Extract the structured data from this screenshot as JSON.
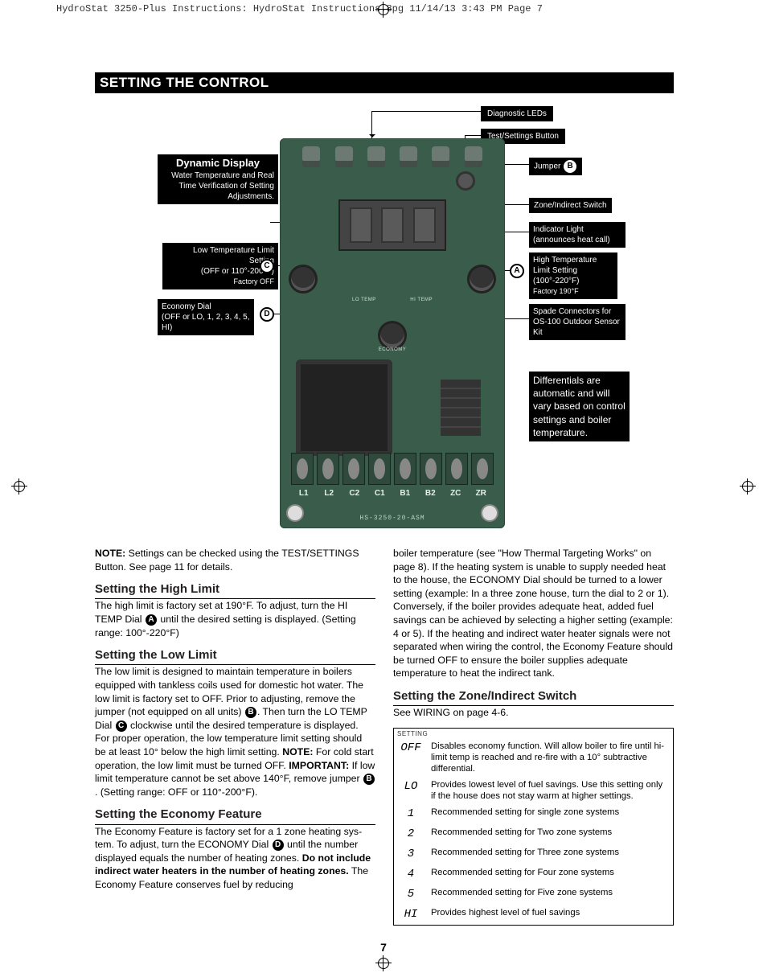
{
  "slug": "HydroStat 3250-Plus Instructions:  HydroStat Instructions.8pg   11/14/13  3:43 PM  Page 7",
  "section_bar": "SETTING THE CONTROL",
  "page_number": "7",
  "diagram": {
    "board_pn": "HS-3250-20-ASM",
    "terminals": [
      "L1",
      "L2",
      "C2",
      "C1",
      "B1",
      "B2",
      "ZC",
      "ZR"
    ],
    "left": {
      "dyn_title": "Dynamic Display",
      "dyn_sub": "Water Temperature and Real Time Verification of Setting Adjustments.",
      "lo_title": "Low Temperature Limit Setting",
      "lo_sub1": "(OFF or 110°-200°F)",
      "lo_sub2": "Factory OFF",
      "econ_title": "Economy Dial",
      "econ_sub": "(OFF or LO, 1, 2, 3, 4, 5, HI)"
    },
    "top": {
      "leds": "Diagnostic LEDs",
      "test": "Test/Settings Button"
    },
    "right": {
      "jumper": "Jumper",
      "zone": "Zone/Indirect Switch",
      "indic1": "Indicator Light",
      "indic2": "(announces heat call)",
      "hi1": "High Temperature Limit Setting",
      "hi2": "(100°-220°F)",
      "hi3": "Factory 190°F",
      "spade": "Spade Connectors for OS-100 Outdoor Sensor Kit",
      "diff": "Differentials are automatic and will vary based on control settings and boiler tem­perature."
    },
    "keys": {
      "A": "A",
      "B": "B",
      "C": "C",
      "D": "D"
    },
    "silk": {
      "lo": "LO TEMP",
      "hi": "HI TEMP",
      "econ": "ECONOMY"
    }
  },
  "col1": {
    "note": "NOTE: Settings can be checked using the TEST/SETTINGS Button. See page 11 for details.",
    "h_high": "Setting the High Limit",
    "p_high": "The high limit is factory set at 190°F. To adjust, turn the HI TEMP Dial {A} until the desired setting is displayed. (Setting range: 100°-220°F)",
    "h_low": "Setting the Low Limit",
    "p_low": "The low limit is designed to maintain temperature in boilers equipped with tankless coils used for domestic hot water. The low limit is factory set to OFF. Prior to adjusting, remove the jumper (not equipped on all units) {B}. Then turn the LO TEMP Dial {C} clockwise until the desired temperature is dis­played. For proper operation, the low temperature limit set­ting should be at least 10° below the high limit setting. NOTE: For cold start operation, the low limit must be turned OFF. IMPORTANT: If low limit temperature cannot be set above 140°F, remove jumper {B}. (Setting range: OFF or 110°-200°F).",
    "h_econ": "Setting the Economy Feature",
    "p_econ": "The Economy Feature is factory set for a 1 zone heating sys­tem. To adjust, turn the ECONOMY Dial {D} until the number displayed equals the number of heating zones. Do not include indirect water heaters in the number of heating zones. The Economy Feature conserves fuel by reducing"
  },
  "col2": {
    "p_cont": "boiler temperature (see \"How Thermal Targeting Works\" on page 8). If the heating system is unable to supply needed heat to the house, the ECONOMY Dial should be turned to a lower setting (example: In a three zone house, turn the dial to 2 or 1). Conversely, if the boiler provides adequate heat, added fuel savings can be achieved by selecting a higher set­ting (example: 4 or 5).  If the heating and indirect water heater signals were not separated when wiring the control, the Economy Feature should be turned OFF to ensure the boiler supplies adequate temperature to heat the indirect tank.",
    "h_zone": "Setting the Zone/Indirect Switch",
    "p_zone": "See WIRING on page 4-6.",
    "settings_hdr": "SETTING",
    "rows": [
      {
        "k": "OFF",
        "v": "Disables economy function. Will allow boiler to fire until hi-limit temp is reached and re-fire with a 10° subtractive differential."
      },
      {
        "k": "LO",
        "v": "Provides lowest level of fuel savings. Use this setting only if the house does not stay warm at higher settings."
      },
      {
        "k": "1",
        "v": "Recommended setting for single zone systems"
      },
      {
        "k": "2",
        "v": "Recommended setting for Two zone systems"
      },
      {
        "k": "3",
        "v": "Recommended setting for Three zone systems"
      },
      {
        "k": "4",
        "v": "Recommended setting for Four zone systems"
      },
      {
        "k": "5",
        "v": "Recommended setting for Five zone systems"
      },
      {
        "k": "HI",
        "v": "Provides highest level of fuel savings"
      }
    ]
  }
}
